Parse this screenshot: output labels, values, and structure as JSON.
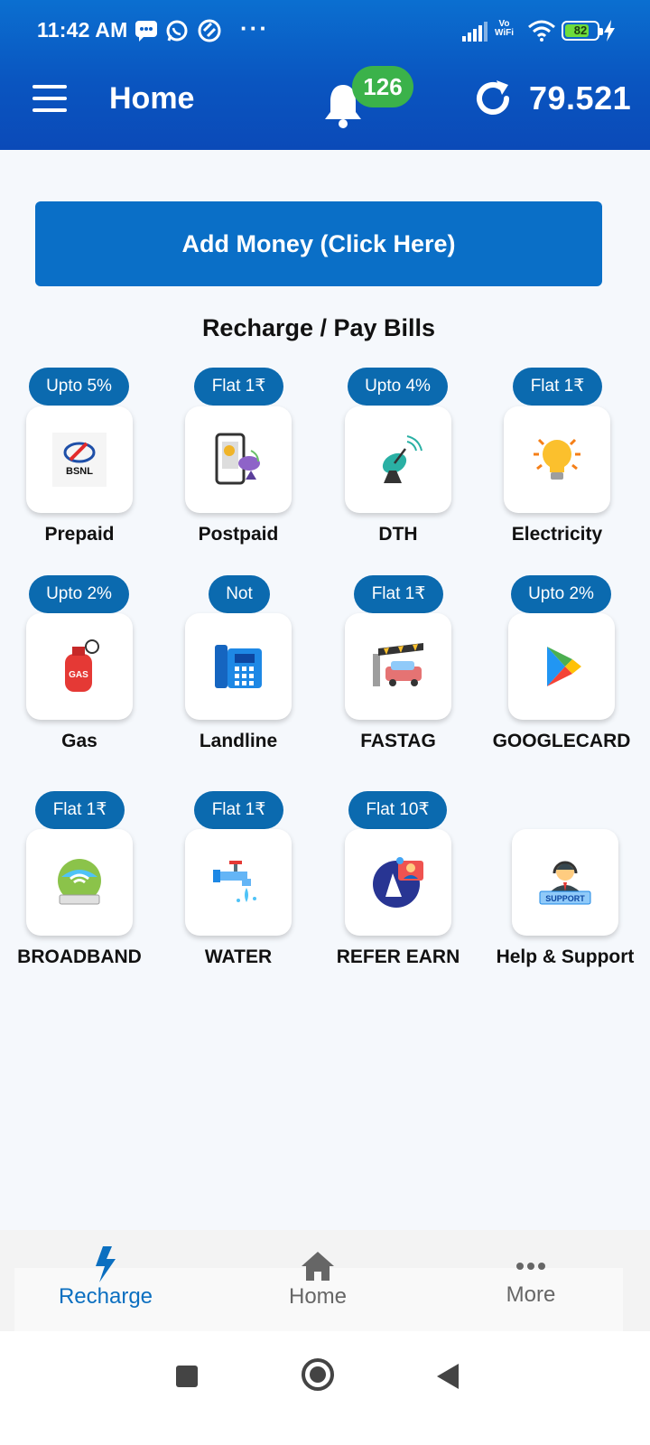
{
  "status_bar": {
    "time": "11:42 AM",
    "dots": "···",
    "vo": "Vo",
    "wifi": "WiFi",
    "battery": "82"
  },
  "header": {
    "title": "Home",
    "notification_count": "126",
    "balance": "79.521"
  },
  "add_money": {
    "label": "Add Money (Click Here)"
  },
  "section": {
    "title": "Recharge / Pay Bills"
  },
  "services": [
    {
      "badge": "Upto 5%",
      "label": "Prepaid",
      "icon": "bsnl-logo-icon"
    },
    {
      "badge": "Flat 1₹",
      "label": "Postpaid",
      "icon": "postpaid-phone-icon"
    },
    {
      "badge": "Upto 4%",
      "label": "DTH",
      "icon": "satellite-dish-icon"
    },
    {
      "badge": "Flat 1₹",
      "label": "Electricity",
      "icon": "light-bulb-icon"
    },
    {
      "badge": "Upto 2%",
      "label": "Gas",
      "icon": "gas-cylinder-icon"
    },
    {
      "badge": "Not",
      "label": "Landline",
      "icon": "landline-phone-icon"
    },
    {
      "badge": "Flat 1₹",
      "label": "FASTAG",
      "icon": "toll-car-icon"
    },
    {
      "badge": "Upto 2%",
      "label": "GOOGLECARD",
      "icon": "google-play-icon"
    },
    {
      "badge": "Flat 1₹",
      "label": "BROADBAND",
      "icon": "broadband-router-icon"
    },
    {
      "badge": "Flat 1₹",
      "label": "WATER",
      "icon": "water-tap-icon"
    },
    {
      "badge": "Flat 10₹",
      "label": "REFER EARN",
      "icon": "refer-earn-icon"
    },
    {
      "badge": "",
      "label": "Help & Support",
      "icon": "support-agent-icon",
      "support_text": "SUPPORT"
    }
  ],
  "bottom_nav": [
    {
      "label": "Recharge",
      "icon": "lightning-icon",
      "active": true
    },
    {
      "label": "Home",
      "icon": "home-icon",
      "active": false
    },
    {
      "label": "More",
      "icon": "more-dots-icon",
      "active": false
    }
  ],
  "colors": {
    "header": "#0a55c0",
    "accent": "#0a6fc7",
    "badge_green": "#3bb24a",
    "pill": "#0b6aaf"
  }
}
